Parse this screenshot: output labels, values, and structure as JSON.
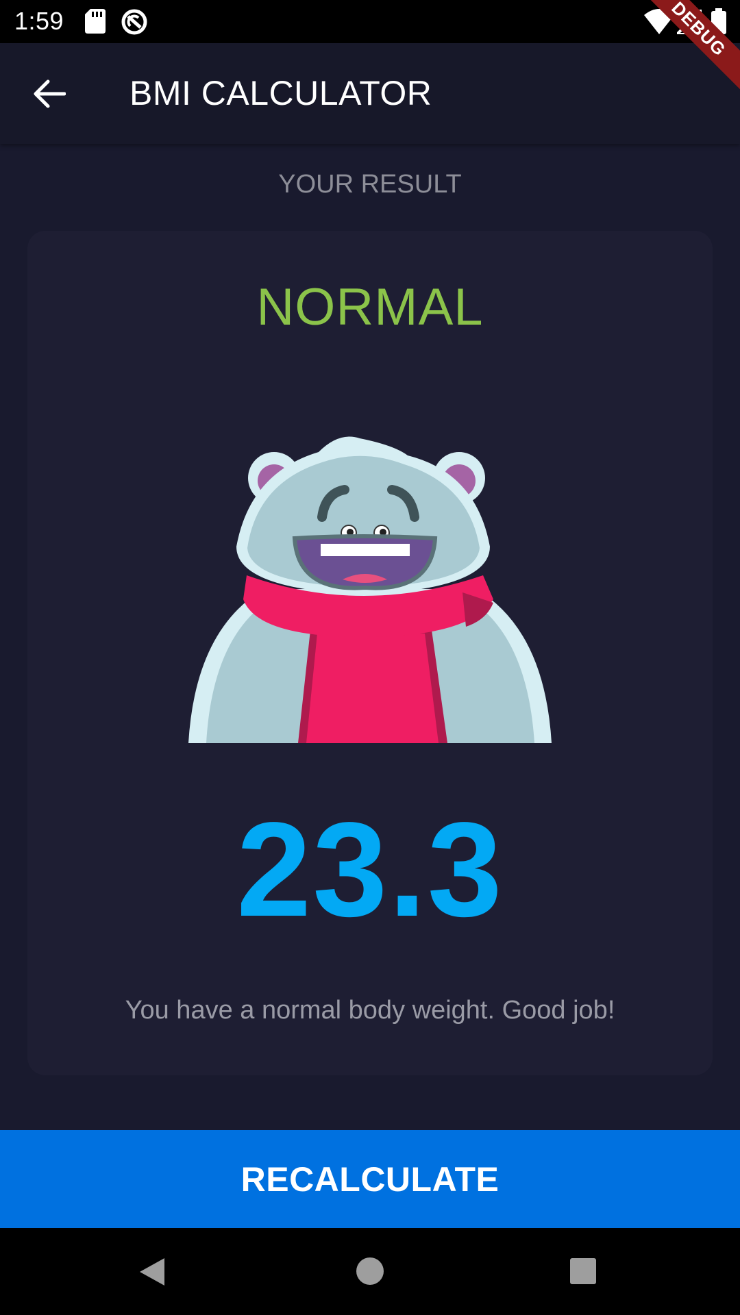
{
  "status_bar": {
    "time": "1:59"
  },
  "app_bar": {
    "title": "BMI CALCULATOR"
  },
  "debug_banner": {
    "label": "DEBUG"
  },
  "result": {
    "heading": "YOUR RESULT",
    "status": "NORMAL",
    "bmi": "23.3",
    "message": "You have a normal body weight. Good job!"
  },
  "recalculate_button": {
    "label": "RECALCULATE"
  },
  "colors": {
    "background": "#191A2E",
    "card": "#1E1E33",
    "status_green": "#8BC34A",
    "bmi_blue": "#03A9F4",
    "button_blue": "#0071E0"
  },
  "icons": {
    "back": "arrow-left-icon",
    "sd_card": "sd-card-icon",
    "sync": "sync-icon",
    "wifi": "wifi-icon",
    "signal": "signal-icon",
    "battery": "battery-icon",
    "mascot": "bear-mascot"
  }
}
